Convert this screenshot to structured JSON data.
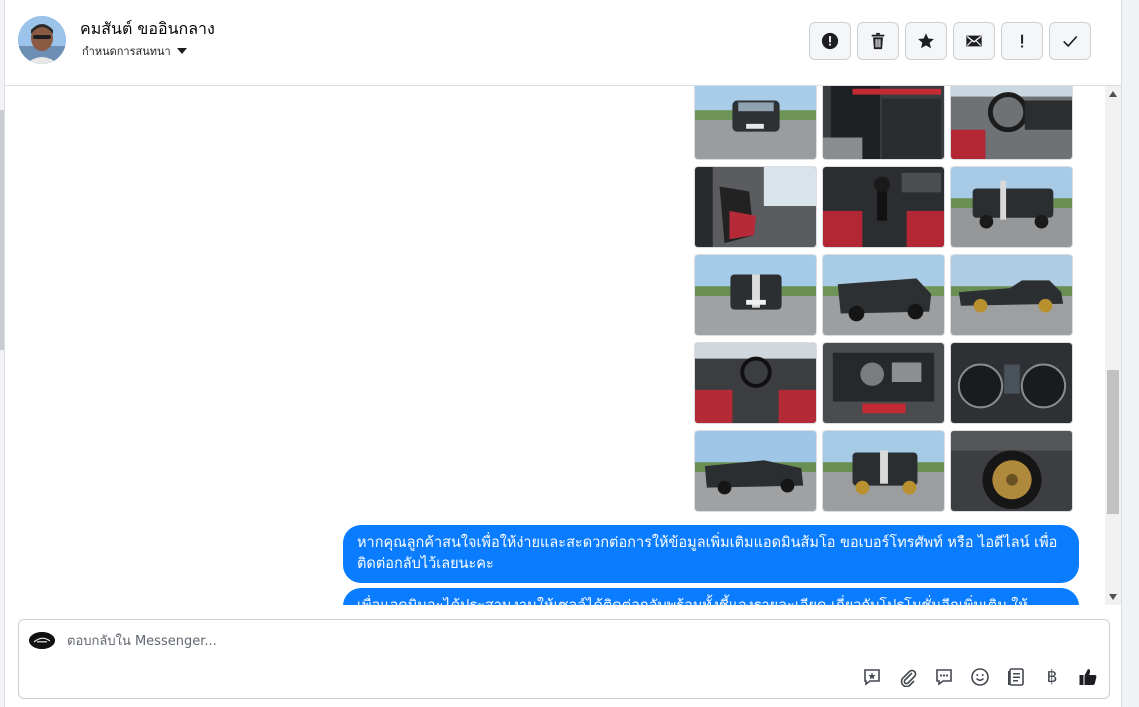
{
  "header": {
    "contact_name": "คมสันต์ ขออินกลาง",
    "assign_label": "กำหนดการสนทนา"
  },
  "actions": [
    {
      "name": "mark-spam-button",
      "icon": "alert-circle-icon"
    },
    {
      "name": "delete-button",
      "icon": "trash-icon"
    },
    {
      "name": "star-button",
      "icon": "star-icon"
    },
    {
      "name": "mark-unread-button",
      "icon": "envelope-icon"
    },
    {
      "name": "follow-up-button",
      "icon": "exclamation-icon"
    },
    {
      "name": "mark-done-button",
      "icon": "checkmark-icon"
    }
  ],
  "messages": [
    {
      "text": "หากคุณลูกค้าสนใจเพื่อให้ง่ายและสะดวกต่อการให้ข้อมูลเพิ่มเติมแอดมินส้มโอ ขอเบอร์โทรศัพท์ หรือ ไอดีไลน์ เพื่อติดต่อกลับไว้เลยนะคะ"
    },
    {
      "text": "เพื่อแอดมินจะได้ประสานงานให้เซลล์ได้ติดต่อกลับพร้อมทั้งชี้แจงรายละเอียด เกี่ยวกับโปรโมชั่นอีกเพิ่มเติม ให้"
    }
  ],
  "composer": {
    "placeholder": "ตอบกลับใน Messenger...",
    "tools": [
      {
        "name": "saved-reply-icon"
      },
      {
        "name": "attachment-icon"
      },
      {
        "name": "quick-reply-icon"
      },
      {
        "name": "emoji-icon"
      },
      {
        "name": "catalog-icon"
      },
      {
        "name": "payment-baht-icon",
        "glyph": "฿"
      },
      {
        "name": "thumbs-up-icon"
      }
    ]
  },
  "colors": {
    "bubble": "#0a7cff",
    "border": "#dadde1",
    "icon": "#444950"
  }
}
